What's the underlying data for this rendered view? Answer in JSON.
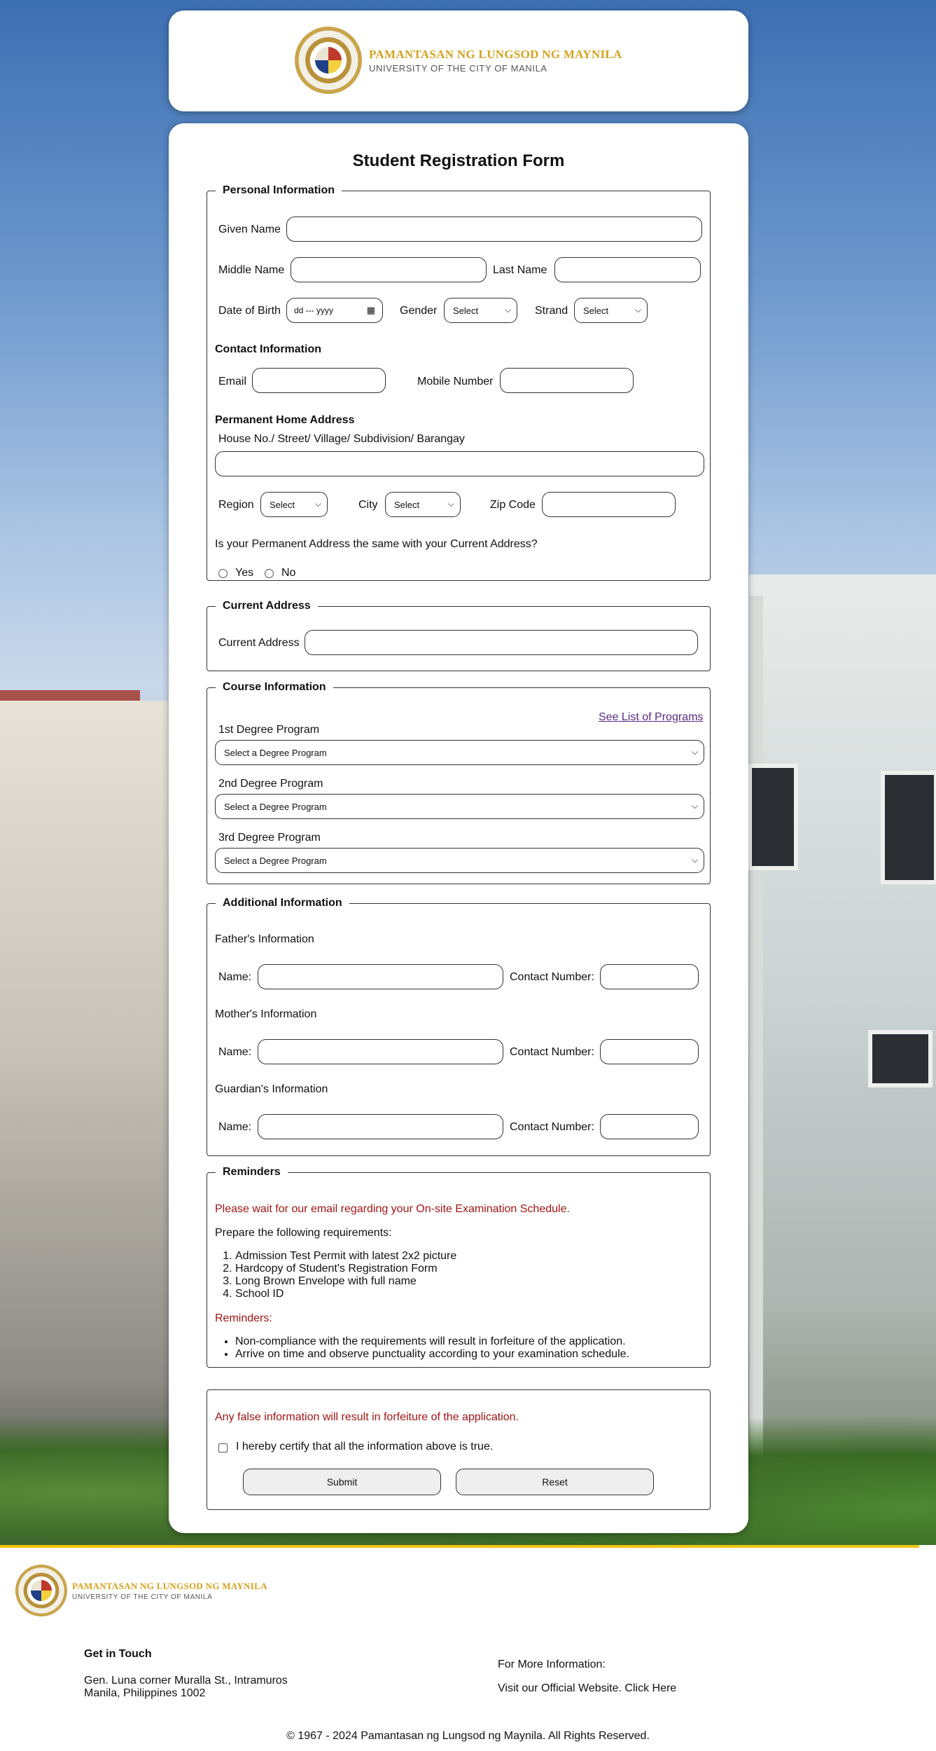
{
  "header": {
    "uni_name": "PAMANTASAN NG LUNGSOD NG MAYNILA",
    "uni_sub": "UNIVERSITY OF THE CITY OF MANILA"
  },
  "form": {
    "title": "Student Registration Form",
    "personal": {
      "legend": "Personal Information",
      "given_name": "Given Name",
      "middle_name": "Middle Name",
      "last_name": "Last Name",
      "dob": "Date of Birth",
      "dob_placeholder": "dd --- yyyy",
      "gender": "Gender",
      "gender_value": "Select",
      "strand": "Strand",
      "strand_value": "Select",
      "contact_heading": "Contact Information",
      "email": "Email",
      "mobile": "Mobile Number",
      "address_heading": "Permanent Home Address",
      "address_line": "House No./ Street/ Village/ Subdivision/ Barangay",
      "region": "Region",
      "region_value": "Select",
      "city": "City",
      "city_value": "Select",
      "zip": "Zip Code",
      "same_question": "Is your Permanent Address the same with your Current Address?",
      "yes": "Yes",
      "no": "No"
    },
    "current": {
      "legend": "Current Address",
      "label": "Current Address"
    },
    "course": {
      "legend": "Course Information",
      "see_list": "See List of Programs",
      "first": "1st Degree Program",
      "second": "2nd Degree Program",
      "third": "3rd Degree Program",
      "select_value": "Select a Degree Program"
    },
    "additional": {
      "legend": "Additional Information",
      "father": "Father's Information",
      "mother": "Mother's Information",
      "guardian": "Guardian's Information",
      "name": "Name:",
      "contact": "Contact Number:"
    },
    "reminders": {
      "legend": "Reminders",
      "wait": "Please wait for our email regarding your On-site Examination Schedule.",
      "prepare": "Prepare the following requirements:",
      "requirements": [
        "Admission Test Permit with latest 2x2 picture",
        "Hardcopy of Student's Registration Form",
        "Long Brown Envelope with full name",
        "School ID"
      ],
      "reminders_label": "Reminders:",
      "notes": [
        "Non-compliance with the requirements will result in forfeiture of the application.",
        "Arrive on time and observe punctuality according to your examination schedule."
      ]
    },
    "certify": {
      "warning": "Any false information will result in forfeiture of the application.",
      "statement": "I hereby certify that all the information above is true.",
      "submit": "Submit",
      "reset": "Reset"
    }
  },
  "footer": {
    "get_in_touch": "Get in Touch",
    "address_1": "Gen. Luna corner Muralla St., Intramuros",
    "address_2": "Manila, Philippines 1002",
    "more_info": "For More Information:",
    "website": "Visit our Official Website. Click Here",
    "copyright": "© 1967 - 2024 Pamantasan ng Lungsod ng Maynila. All Rights Reserved."
  }
}
